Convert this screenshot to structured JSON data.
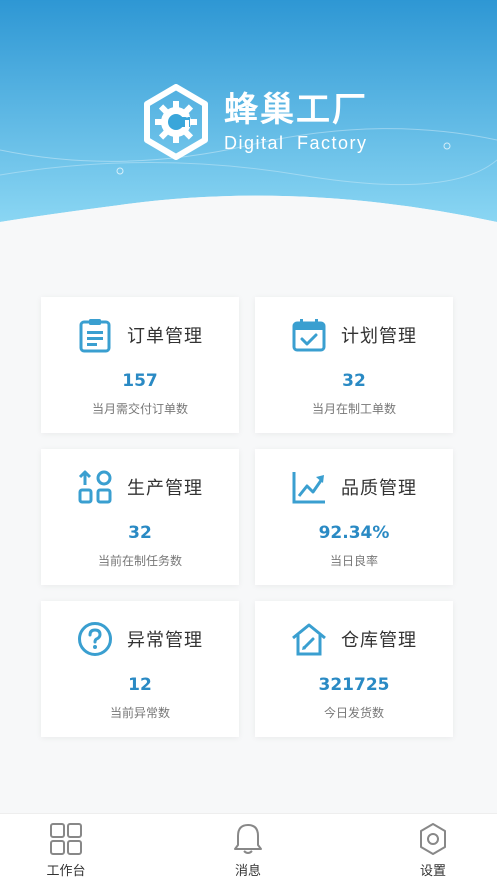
{
  "brand": {
    "name_cn": "蜂巢工厂",
    "name_en": "Digital Factory"
  },
  "colors": {
    "header_top": "#2e97d4",
    "header_bottom": "#84d3f2",
    "accent": "#2a8ac4",
    "icon": "#3a9fd0",
    "page_bg": "#f7f8f9"
  },
  "cards": [
    {
      "title": "订单管理",
      "value": "157",
      "desc": "当月需交付订单数",
      "icon": "clipboard-icon"
    },
    {
      "title": "计划管理",
      "value": "32",
      "desc": "当月在制工单数",
      "icon": "calendar-check-icon"
    },
    {
      "title": "生产管理",
      "value": "32",
      "desc": "当前在制任务数",
      "icon": "production-grid-icon"
    },
    {
      "title": "品质管理",
      "value": "92.34%",
      "desc": "当日良率",
      "icon": "trend-chart-icon"
    },
    {
      "title": "异常管理",
      "value": "12",
      "desc": "当前异常数",
      "icon": "question-circle-icon"
    },
    {
      "title": "仓库管理",
      "value": "321725",
      "desc": "今日发货数",
      "icon": "warehouse-icon"
    }
  ],
  "tabbar": [
    {
      "label": "工作台",
      "icon": "workbench-grid-icon"
    },
    {
      "label": "消息",
      "icon": "bell-icon"
    },
    {
      "label": "设置",
      "icon": "settings-gear-icon"
    }
  ]
}
